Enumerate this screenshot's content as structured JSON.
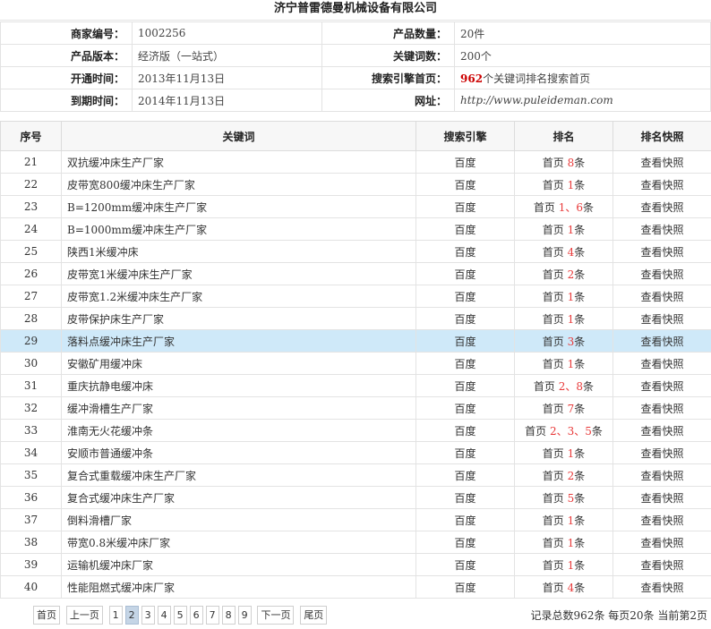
{
  "company": "济宁普雷德曼机械设备有限公司",
  "info": {
    "merchant_id_label": "商家编号：",
    "merchant_id": "1002256",
    "product_count_label": "产品数量：",
    "product_count": "20件",
    "version_label": "产品版本：",
    "version": "经济版（一站式）",
    "keyword_count_label": "关键词数：",
    "keyword_count": "200个",
    "open_label": "开通时间：",
    "open_date": "2013年11月13日",
    "search_home_label": "搜索引擎首页：",
    "search_home_count": "962",
    "search_home_text": "个关键词排名搜索首页",
    "expire_label": "到期时间：",
    "expire_date": "2014年11月13日",
    "url_label": "网址：",
    "url": "http://www.puleideman.com"
  },
  "table": {
    "headers": [
      "序号",
      "关键词",
      "搜索引擎",
      "排名",
      "排名快照"
    ],
    "rows": [
      {
        "no": "21",
        "keyword": "双抗缓冲床生产厂家",
        "engine": "百度",
        "prefix": "首页",
        "rank": "8",
        "suffix": "条",
        "snapshot": "查看快照"
      },
      {
        "no": "22",
        "keyword": "皮带宽800缓冲床生产厂家",
        "engine": "百度",
        "prefix": "首页",
        "rank": "1",
        "suffix": "条",
        "snapshot": "查看快照"
      },
      {
        "no": "23",
        "keyword": "B=1200mm缓冲床生产厂家",
        "engine": "百度",
        "prefix": "首页",
        "rank": "1、6",
        "suffix": "条",
        "snapshot": "查看快照"
      },
      {
        "no": "24",
        "keyword": "B=1000mm缓冲床生产厂家",
        "engine": "百度",
        "prefix": "首页",
        "rank": "1",
        "suffix": "条",
        "snapshot": "查看快照"
      },
      {
        "no": "25",
        "keyword": "陕西1米缓冲床",
        "engine": "百度",
        "prefix": "首页",
        "rank": "4",
        "suffix": "条",
        "snapshot": "查看快照"
      },
      {
        "no": "26",
        "keyword": "皮带宽1米缓冲床生产厂家",
        "engine": "百度",
        "prefix": "首页",
        "rank": "2",
        "suffix": "条",
        "snapshot": "查看快照"
      },
      {
        "no": "27",
        "keyword": "皮带宽1.2米缓冲床生产厂家",
        "engine": "百度",
        "prefix": "首页",
        "rank": "1",
        "suffix": "条",
        "snapshot": "查看快照"
      },
      {
        "no": "28",
        "keyword": "皮带保护床生产厂家",
        "engine": "百度",
        "prefix": "首页",
        "rank": "1",
        "suffix": "条",
        "snapshot": "查看快照"
      },
      {
        "no": "29",
        "keyword": "落料点缓冲床生产厂家",
        "engine": "百度",
        "prefix": "首页",
        "rank": "3",
        "suffix": "条",
        "snapshot": "查看快照",
        "highlight": true
      },
      {
        "no": "30",
        "keyword": "安徽矿用缓冲床",
        "engine": "百度",
        "prefix": "首页",
        "rank": "1",
        "suffix": "条",
        "snapshot": "查看快照"
      },
      {
        "no": "31",
        "keyword": "重庆抗静电缓冲床",
        "engine": "百度",
        "prefix": "首页",
        "rank": "2、8",
        "suffix": "条",
        "snapshot": "查看快照"
      },
      {
        "no": "32",
        "keyword": "缓冲滑槽生产厂家",
        "engine": "百度",
        "prefix": "首页",
        "rank": "7",
        "suffix": "条",
        "snapshot": "查看快照"
      },
      {
        "no": "33",
        "keyword": "淮南无火花缓冲条",
        "engine": "百度",
        "prefix": "首页",
        "rank": "2、3、5",
        "suffix": "条",
        "snapshot": "查看快照"
      },
      {
        "no": "34",
        "keyword": "安顺市普通缓冲条",
        "engine": "百度",
        "prefix": "首页",
        "rank": "1",
        "suffix": "条",
        "snapshot": "查看快照"
      },
      {
        "no": "35",
        "keyword": "复合式重载缓冲床生产厂家",
        "engine": "百度",
        "prefix": "首页",
        "rank": "2",
        "suffix": "条",
        "snapshot": "查看快照"
      },
      {
        "no": "36",
        "keyword": "复合式缓冲床生产厂家",
        "engine": "百度",
        "prefix": "首页",
        "rank": "5",
        "suffix": "条",
        "snapshot": "查看快照"
      },
      {
        "no": "37",
        "keyword": "倒料滑槽厂家",
        "engine": "百度",
        "prefix": "首页",
        "rank": "1",
        "suffix": "条",
        "snapshot": "查看快照"
      },
      {
        "no": "38",
        "keyword": "带宽0.8米缓冲床厂家",
        "engine": "百度",
        "prefix": "首页",
        "rank": "1",
        "suffix": "条",
        "snapshot": "查看快照"
      },
      {
        "no": "39",
        "keyword": "运输机缓冲床厂家",
        "engine": "百度",
        "prefix": "首页",
        "rank": "1",
        "suffix": "条",
        "snapshot": "查看快照"
      },
      {
        "no": "40",
        "keyword": "性能阻燃式缓冲床厂家",
        "engine": "百度",
        "prefix": "首页",
        "rank": "4",
        "suffix": "条",
        "snapshot": "查看快照"
      }
    ]
  },
  "pager": {
    "first": "首页",
    "prev": "上一页",
    "pages": [
      "1",
      "2",
      "3",
      "4",
      "5",
      "6",
      "7",
      "8",
      "9"
    ],
    "current": "2",
    "next": "下一页",
    "last": "尾页"
  },
  "summary": "记录总数962条 每页20条 当前第2页",
  "colors": {
    "rank_red": "#e83a3a",
    "highlight_row": "#cfe9f9",
    "current_page": "#c5d5e6"
  }
}
